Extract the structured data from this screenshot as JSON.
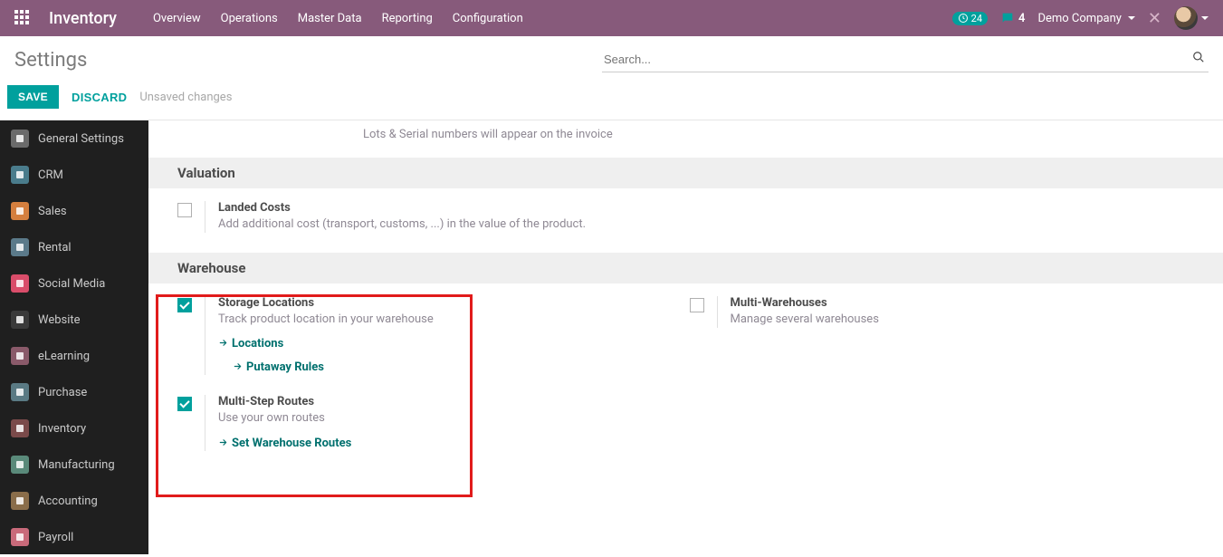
{
  "navbar": {
    "brand": "Inventory",
    "menu": [
      "Overview",
      "Operations",
      "Master Data",
      "Reporting",
      "Configuration"
    ],
    "activity_count": "24",
    "chat_count": "4",
    "company": "Demo Company"
  },
  "page": {
    "title": "Settings",
    "search_placeholder": "Search...",
    "save_label": "SAVE",
    "discard_label": "DISCARD",
    "unsaved_label": "Unsaved changes"
  },
  "sidebar": {
    "items": [
      {
        "label": "General Settings",
        "color": "#6b6b6b"
      },
      {
        "label": "CRM",
        "color": "#4a7c8c"
      },
      {
        "label": "Sales",
        "color": "#d57f3e"
      },
      {
        "label": "Rental",
        "color": "#5b7a8a"
      },
      {
        "label": "Social Media",
        "color": "#d94d6a"
      },
      {
        "label": "Website",
        "color": "#3a3a3a"
      },
      {
        "label": "eLearning",
        "color": "#8a5a6a"
      },
      {
        "label": "Purchase",
        "color": "#5a7a84"
      },
      {
        "label": "Inventory",
        "color": "#7a4a4a"
      },
      {
        "label": "Manufacturing",
        "color": "#5a8a7a"
      },
      {
        "label": "Accounting",
        "color": "#8a6d4a"
      },
      {
        "label": "Payroll",
        "color": "#c96a7a"
      }
    ]
  },
  "content": {
    "top_note": "Lots & Serial numbers will appear on the invoice",
    "valuation_header": "Valuation",
    "landed_title": "Landed Costs",
    "landed_desc": "Add additional cost (transport, customs, ...) in the value of the product.",
    "warehouse_header": "Warehouse",
    "storage_title": "Storage Locations",
    "storage_desc": "Track product location in your warehouse",
    "locations_link": "Locations",
    "putaway_link": "Putaway Rules",
    "multi_wh_title": "Multi-Warehouses",
    "multi_wh_desc": "Manage several warehouses",
    "msr_title": "Multi-Step Routes",
    "msr_desc": "Use your own routes",
    "routes_link": "Set Warehouse Routes"
  }
}
